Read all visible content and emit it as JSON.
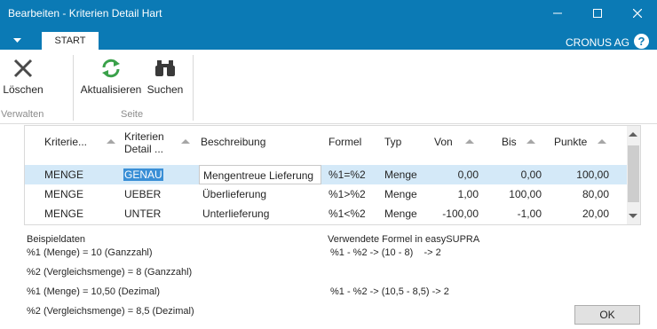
{
  "window": {
    "title": "Bearbeiten - Kriterien Detail Hart"
  },
  "tabbar": {
    "tab_start": "START",
    "company": "CRONUS AG"
  },
  "ribbon": {
    "buttons": {
      "delete": "Löschen",
      "refresh": "Aktualisieren",
      "search": "Suchen"
    },
    "groups": {
      "manage": "Verwalten",
      "page": "Seite"
    }
  },
  "grid": {
    "columns": {
      "kriterium": "Kriterie...",
      "detail_line1": "Kriterien",
      "detail_line2": "Detail ...",
      "beschreibung": "Beschreibung",
      "formel": "Formel",
      "typ": "Typ",
      "von": "Von",
      "bis": "Bis",
      "punkte": "Punkte"
    },
    "rows": [
      {
        "kriterium": "MENGE",
        "detail": "GENAU",
        "beschreibung": "Mengentreue Lieferung",
        "formel": "%1=%2",
        "typ": "Menge",
        "von": "0,00",
        "bis": "0,00",
        "punkte": "100,00"
      },
      {
        "kriterium": "MENGE",
        "detail": "UEBER",
        "beschreibung": "Überlieferung",
        "formel": "%1>%2",
        "typ": "Menge",
        "von": "1,00",
        "bis": "100,00",
        "punkte": "80,00"
      },
      {
        "kriterium": "MENGE",
        "detail": "UNTER",
        "beschreibung": "Unterlieferung",
        "formel": "%1<%2",
        "typ": "Menge",
        "von": "-100,00",
        "bis": "-1,00",
        "punkte": "20,00"
      }
    ]
  },
  "info": {
    "example_heading": "Beispieldaten",
    "example_1": "%1 (Menge) = 10 (Ganzzahl)",
    "example_2": "%2 (Vergleichsmenge) = 8 (Ganzzahl)",
    "example_3": "%1 (Menge) = 10,50 (Dezimal)",
    "example_4": "%2 (Vergleichsmenge) = 8,5 (Dezimal)",
    "formula_heading": "Verwendete Formel in easySUPRA",
    "formula_1": "%1 - %2 -> (10 - 8)    -> 2",
    "formula_2": "%1 - %2 -> (10,5 - 8,5) -> 2"
  },
  "buttons": {
    "ok": "OK"
  },
  "colors": {
    "accent": "#0b7ab5",
    "selected_row": "#d4e9f8",
    "refresh_icon": "#3aa14a"
  }
}
